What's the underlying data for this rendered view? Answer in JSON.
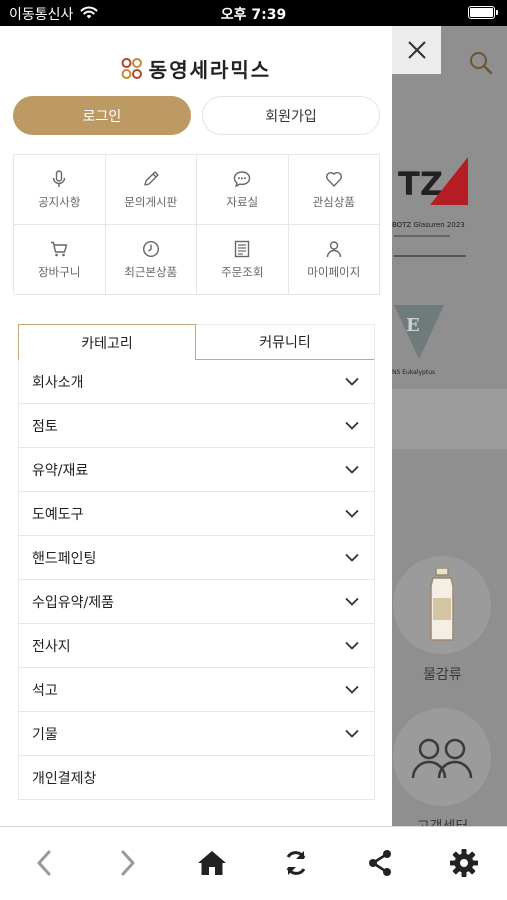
{
  "status_bar": {
    "carrier": "이동통신사",
    "time": "오후 7:39"
  },
  "logo": {
    "text": "동영세라믹스"
  },
  "auth": {
    "login_label": "로그인",
    "join_label": "회원가입"
  },
  "quick_menu": [
    {
      "label": "공지사항",
      "icon": "mic-icon"
    },
    {
      "label": "문의게시판",
      "icon": "pencil-icon"
    },
    {
      "label": "자료실",
      "icon": "chat-bubble-icon"
    },
    {
      "label": "관심상품",
      "icon": "heart-icon"
    },
    {
      "label": "장바구니",
      "icon": "cart-icon"
    },
    {
      "label": "최근본상품",
      "icon": "clock-icon"
    },
    {
      "label": "주문조회",
      "icon": "document-list-icon"
    },
    {
      "label": "마이페이지",
      "icon": "person-icon"
    }
  ],
  "tabs": {
    "category": "카테고리",
    "community": "커뮤니티",
    "active": "category"
  },
  "categories": [
    {
      "label": "회사소개",
      "expandable": true
    },
    {
      "label": "점토",
      "expandable": true
    },
    {
      "label": "유약/재료",
      "expandable": true
    },
    {
      "label": "도예도구",
      "expandable": true
    },
    {
      "label": "핸드페인팅",
      "expandable": true
    },
    {
      "label": "수입유약/제품",
      "expandable": true
    },
    {
      "label": "전사지",
      "expandable": true
    },
    {
      "label": "석고",
      "expandable": true
    },
    {
      "label": "기물",
      "expandable": true
    },
    {
      "label": "개인결제창",
      "expandable": false
    }
  ],
  "background": {
    "banner1_title": "TZ",
    "banner1_sub": "BOTZ Glasuren 2023",
    "banner2_sub": "NS Eukalyptus",
    "tile1_label": "물감류",
    "tile2_label": "고객센터"
  },
  "colors": {
    "accent": "#bd9a64",
    "tab_border": "#c9a877",
    "banner_red": "#b51d24"
  }
}
